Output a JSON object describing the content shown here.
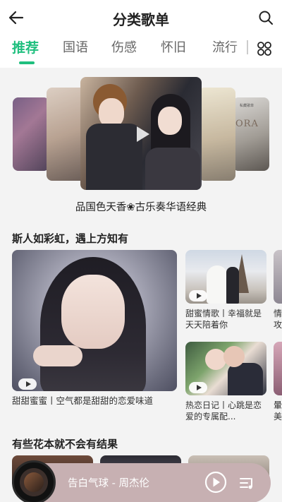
{
  "header": {
    "title": "分类歌单"
  },
  "tabs": [
    {
      "label": "推荐",
      "active": true
    },
    {
      "label": "国语"
    },
    {
      "label": "伤感"
    },
    {
      "label": "怀旧"
    },
    {
      "label": "流行"
    }
  ],
  "carousel": {
    "caption": "品国色天香❀古乐奏华语经典",
    "cover_text_right": "ORA",
    "cover_text_right_small": "私藏歌单"
  },
  "section1": {
    "title": "斯人如彩虹，遇上方知有",
    "big_caption": "甜甜蜜蜜丨空气都是甜甜的恋爱味道",
    "cards": [
      {
        "caption": "甜蜜情歌丨幸福就是天天陪着你"
      },
      {
        "caption": "热恋日记丨心跳是恋爱的专属配..."
      }
    ],
    "peek_captions": [
      "情",
      "攻",
      "暈",
      "美"
    ]
  },
  "section2": {
    "title": "有些花本就不会有结果"
  },
  "player": {
    "song": "告白气球 - 周杰伦"
  },
  "colors": {
    "accent": "#1fbf7e",
    "player_bg": "#c7b0b2"
  }
}
